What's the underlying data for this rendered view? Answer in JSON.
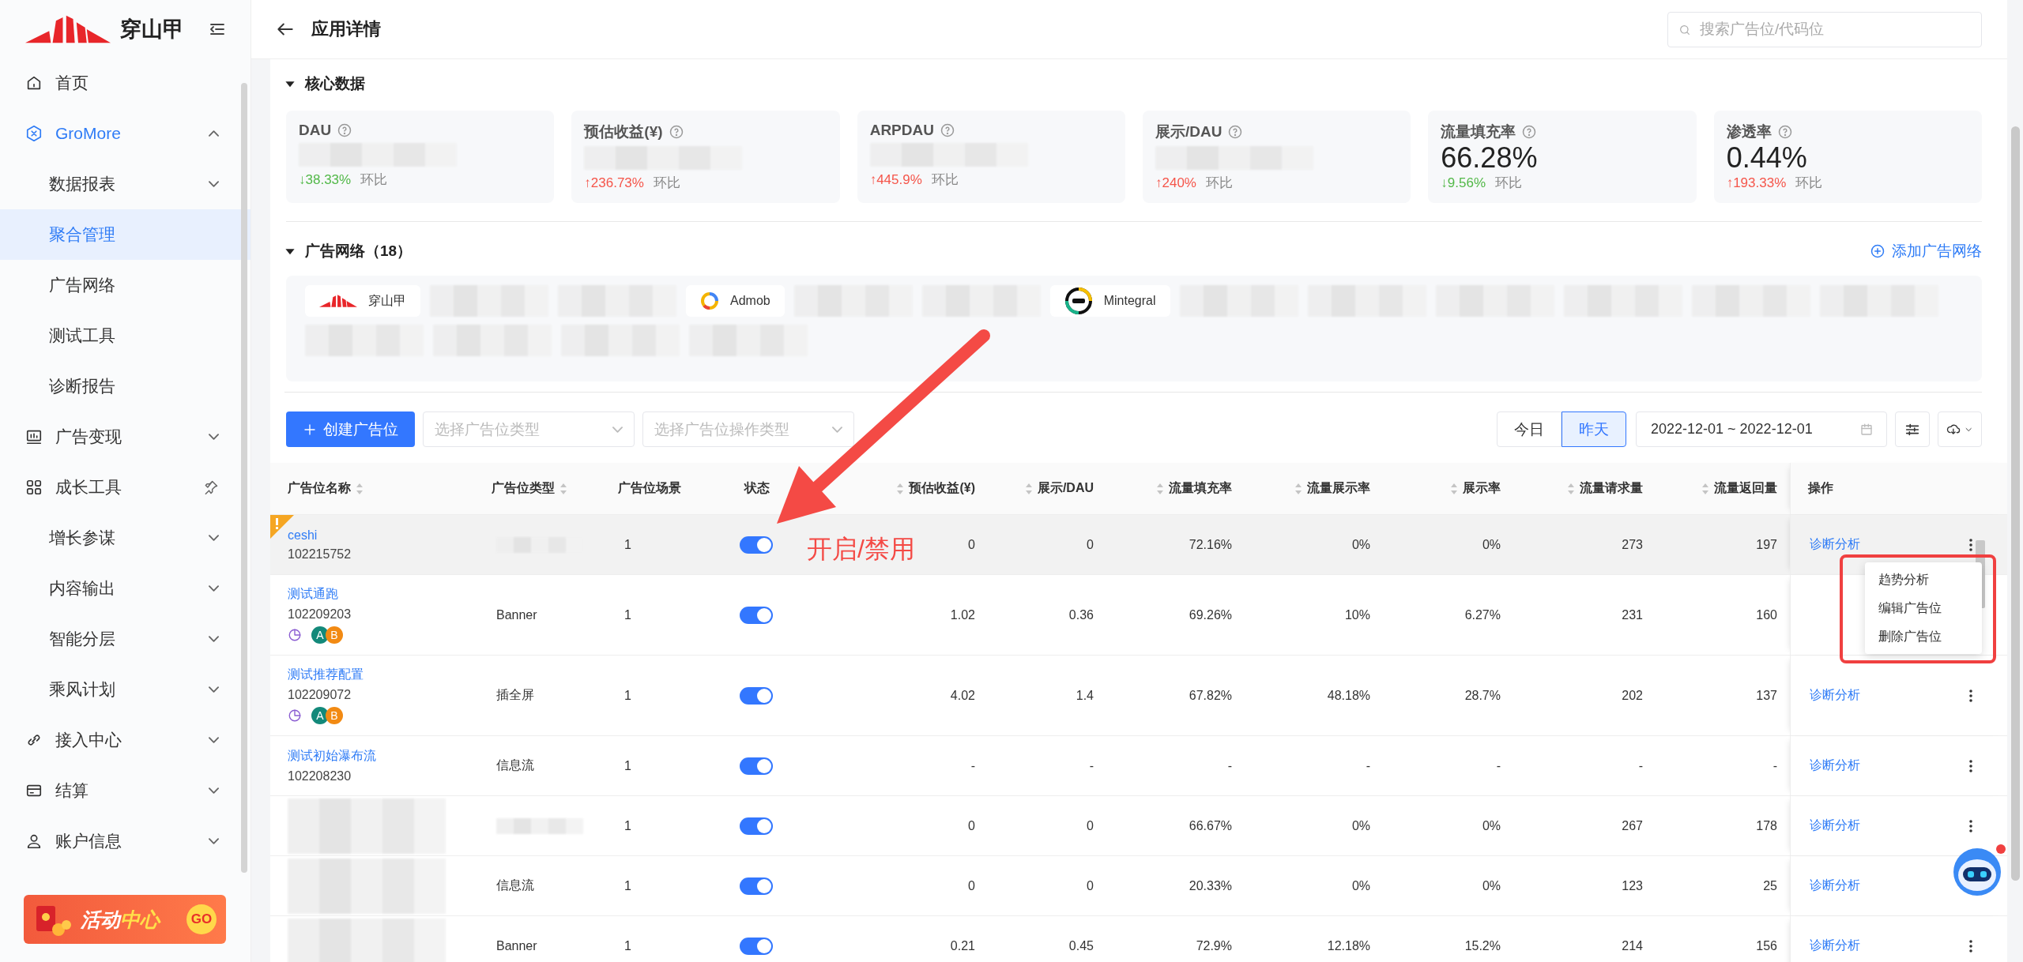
{
  "sidebar": {
    "logo": "穿山甲",
    "items": [
      {
        "label": "首页",
        "selected": false
      },
      {
        "label": "GroMore",
        "selected": false,
        "active": true,
        "expanded": true,
        "children": [
          {
            "label": "数据报表",
            "selected": false,
            "expanded": false
          },
          {
            "label": "聚合管理",
            "selected": true
          },
          {
            "label": "广告网络",
            "selected": false
          },
          {
            "label": "测试工具",
            "selected": false
          },
          {
            "label": "诊断报告",
            "selected": false
          }
        ]
      },
      {
        "label": "广告变现",
        "selected": false,
        "expanded": false
      },
      {
        "label": "成长工具",
        "selected": false,
        "pinned": true,
        "expanded": true,
        "children": [
          {
            "label": "增长参谋",
            "selected": false,
            "expanded": false
          },
          {
            "label": "内容输出",
            "selected": false,
            "expanded": false
          },
          {
            "label": "智能分层",
            "selected": false,
            "expanded": false
          },
          {
            "label": "乘风计划",
            "selected": false,
            "expanded": false
          }
        ]
      },
      {
        "label": "接入中心",
        "selected": false,
        "expanded": false
      },
      {
        "label": "结算",
        "selected": false,
        "expanded": false
      },
      {
        "label": "账户信息",
        "selected": false,
        "expanded": false
      }
    ],
    "promo": {
      "label": "活动**中心**",
      "button": "GO"
    }
  },
  "topbar": {
    "title": "应用详情",
    "search": {
      "placeholder": "搜索广告位/代码位"
    }
  },
  "core": {
    "title": "核心数据",
    "expanded": true,
    "metrics": [
      {
        "label": "DAU",
        "blurred": true,
        "change": "↓38.33%",
        "color": "#52b848",
        "compare": "环比"
      },
      {
        "label": "预估收益(¥)",
        "blurred": true,
        "change": "↑236.73%",
        "color": "#f5554a",
        "compare": "环比"
      },
      {
        "label": "ARPDAU",
        "blurred": true,
        "change": "↑445.9%",
        "color": "#f5554a",
        "compare": "环比"
      },
      {
        "label": "展示/DAU",
        "blurred": true,
        "change": "↑240%",
        "color": "#f5554a",
        "compare": "环比"
      },
      {
        "label": "流量填充率",
        "value": "66.28%",
        "change": "↓9.56%",
        "color": "#52b848",
        "compare": "环比"
      },
      {
        "label": "渗透率",
        "value": "0.44%",
        "change": "↑193.33%",
        "color": "#f5554a",
        "compare": "环比"
      }
    ]
  },
  "networks": {
    "title": "广告网络（18）",
    "expanded": true,
    "add": "添加广告网络",
    "items": [
      {
        "kind": "network",
        "name": "穿山甲"
      },
      {
        "kind": "blurred"
      },
      {
        "kind": "blurred"
      },
      {
        "kind": "network",
        "name": "Admob"
      },
      {
        "kind": "blurred"
      },
      {
        "kind": "blurred"
      },
      {
        "kind": "network",
        "name": "Mintegral"
      },
      {
        "kind": "blurred"
      },
      {
        "kind": "blurred"
      },
      {
        "kind": "blurred"
      },
      {
        "kind": "blurred"
      },
      {
        "kind": "blurred"
      },
      {
        "kind": "blurred"
      },
      {
        "kind": "blurred"
      },
      {
        "kind": "blurred"
      },
      {
        "kind": "blurred"
      },
      {
        "kind": "blurred"
      }
    ]
  },
  "toolbar": {
    "create": "创建广告位",
    "filters": [
      {
        "placeholder": "选择广告位类型"
      },
      {
        "placeholder": "选择广告位操作类型"
      }
    ],
    "range": [
      {
        "label": "今日",
        "selected": false
      },
      {
        "label": "昨天",
        "selected": true
      }
    ],
    "date": "2022-12-01 ~ 2022-12-01"
  },
  "table": {
    "columns": [
      {
        "label": "广告位名称",
        "sortable": true
      },
      {
        "label": "广告位类型",
        "sortable": true
      },
      {
        "label": "广告位场景",
        "sortable": false
      },
      {
        "label": "状态",
        "sortable": false
      },
      {
        "label": "预估收益(¥)",
        "sortable": true
      },
      {
        "label": "展示/DAU",
        "sortable": true
      },
      {
        "label": "流量填充率",
        "sortable": true
      },
      {
        "label": "流量展示率",
        "sortable": true
      },
      {
        "label": "展示率",
        "sortable": true
      },
      {
        "label": "流量请求量",
        "sortable": true
      },
      {
        "label": "流量返回量",
        "sortable": true
      },
      {
        "label": "操作",
        "sortable": false
      }
    ],
    "rows": [
      {
        "name": "ceshi",
        "id": "102215752",
        "warning": true,
        "highlighted": true,
        "type_blurred": true,
        "scene": "1",
        "enabled": true,
        "values": [
          "0",
          "0",
          "72.16%",
          "0%",
          "0%",
          "273",
          "197"
        ],
        "action": "诊断分析"
      },
      {
        "name": "测试通跑",
        "id": "102209203",
        "warning": false,
        "highlighted": false,
        "strategy": true,
        "tags": [
          "A",
          "B"
        ],
        "type": "Banner",
        "scene": "1",
        "enabled": true,
        "values": [
          "1.02",
          "0.36",
          "69.26%",
          "10%",
          "6.27%",
          "231",
          "160"
        ]
      },
      {
        "name": "测试推荐配置",
        "id": "102209072",
        "warning": false,
        "highlighted": false,
        "strategy": true,
        "tags": [
          "A",
          "B"
        ],
        "type": "插全屏",
        "scene": "1",
        "enabled": true,
        "values": [
          "4.02",
          "1.4",
          "67.82%",
          "48.18%",
          "28.7%",
          "202",
          "137"
        ],
        "action": "诊断分析"
      },
      {
        "name": "测试初始瀑布流",
        "id": "102208230",
        "warning": false,
        "highlighted": false,
        "type": "信息流",
        "scene": "1",
        "enabled": true,
        "values": [
          "-",
          "-",
          "-",
          "-",
          "-",
          "-",
          "-"
        ],
        "action": "诊断分析"
      },
      {
        "name_blurred": true,
        "warning": false,
        "highlighted": false,
        "type_blurred": true,
        "scene": "1",
        "enabled": true,
        "values": [
          "0",
          "0",
          "66.67%",
          "0%",
          "0%",
          "267",
          "178"
        ],
        "action": "诊断分析"
      },
      {
        "name_blurred": true,
        "warning": false,
        "highlighted": false,
        "type": "信息流",
        "scene": "1",
        "enabled": true,
        "values": [
          "0",
          "0",
          "20.33%",
          "0%",
          "0%",
          "123",
          "25"
        ],
        "action": "诊断分析"
      },
      {
        "name_blurred": true,
        "warning": false,
        "highlighted": false,
        "type": "Banner",
        "scene": "1",
        "enabled": true,
        "values": [
          "0.21",
          "0.45",
          "72.9%",
          "12.18%",
          "15.2%",
          "214",
          "156"
        ],
        "action": "诊断分析"
      }
    ]
  },
  "menu": {
    "items": [
      "趋势分析",
      "编辑广告位",
      "删除广告位"
    ]
  },
  "annotation": {
    "label": "开启/禁用"
  },
  "assistant": {
    "notification": true
  }
}
